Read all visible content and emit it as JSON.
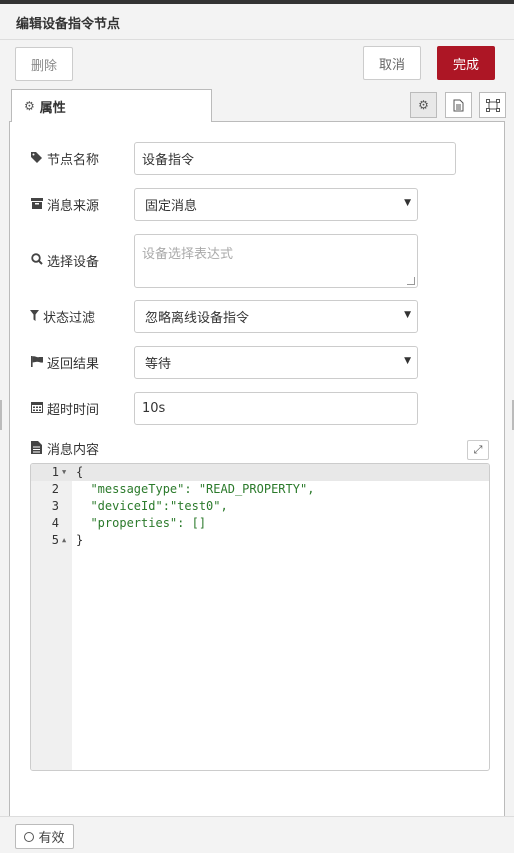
{
  "dialog": {
    "title": "编辑设备指令节点"
  },
  "toolbar": {
    "delete_label": "删除",
    "cancel_label": "取消",
    "done_label": "完成"
  },
  "tabs": [
    {
      "label": "属性",
      "icon": "gear-icon"
    }
  ],
  "tab_buttons": [
    {
      "icon": "gear-icon"
    },
    {
      "icon": "document-icon"
    },
    {
      "icon": "frame-icon"
    }
  ],
  "form": {
    "name": {
      "label": "节点名称",
      "icon": "tag-icon",
      "value": "设备指令"
    },
    "source": {
      "label": "消息来源",
      "icon": "archive-icon",
      "value": "固定消息"
    },
    "device": {
      "label": "选择设备",
      "icon": "search-icon",
      "placeholder": "设备选择表达式"
    },
    "filter": {
      "label": "状态过滤",
      "icon": "filter-icon",
      "value": "忽略离线设备指令"
    },
    "result": {
      "label": "返回结果",
      "icon": "flag-icon",
      "value": "等待"
    },
    "timeout": {
      "label": "超时时间",
      "icon": "calendar-icon",
      "value": "10s"
    },
    "content": {
      "label": "消息内容",
      "icon": "file-icon"
    }
  },
  "editor": {
    "lines": [
      {
        "n": "1",
        "text": "{"
      },
      {
        "n": "2",
        "text": "  \"messageType\": \"READ_PROPERTY\","
      },
      {
        "n": "3",
        "text": "  \"deviceId\":\"test0\","
      },
      {
        "n": "4",
        "text": "  \"properties\": []"
      },
      {
        "n": "5",
        "text": "}"
      }
    ]
  },
  "footer": {
    "enabled_label": "有效"
  },
  "colors": {
    "accent": "#ad1625",
    "json_key": "#2b7a2b"
  }
}
